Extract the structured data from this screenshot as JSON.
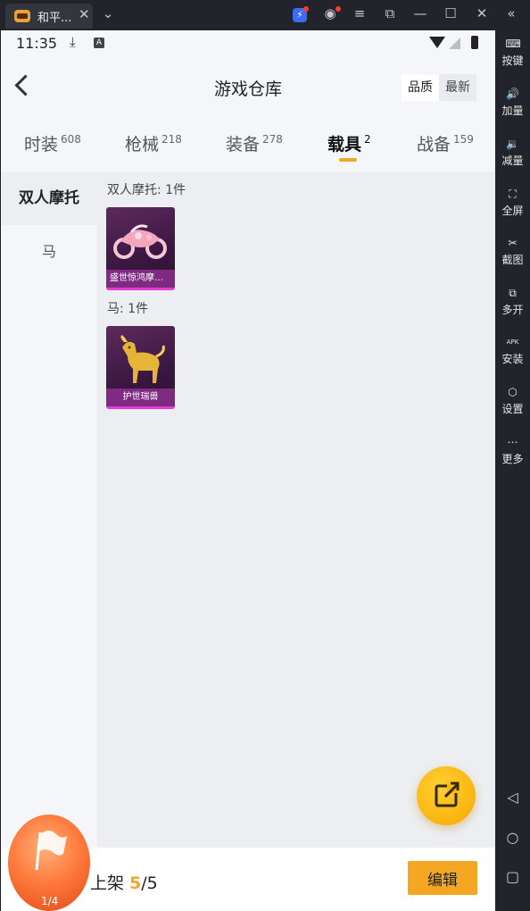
{
  "window": {
    "tab_title": "和平...",
    "tab_close": "✕",
    "controls": {
      "menu": "≡",
      "minimize": "—",
      "maximize": "☐",
      "close": "✕",
      "collapse": "«"
    }
  },
  "emulator_sidebar": {
    "items": [
      {
        "label": "按键",
        "icon": "keyboard-icon",
        "glyph": "⌨"
      },
      {
        "label": "加量",
        "icon": "volume-up-icon",
        "glyph": "🔊"
      },
      {
        "label": "减量",
        "icon": "volume-down-icon",
        "glyph": "🔉"
      },
      {
        "label": "全屏",
        "icon": "fullscreen-icon",
        "glyph": "⛶"
      },
      {
        "label": "截图",
        "icon": "scissors-icon",
        "glyph": "✂"
      },
      {
        "label": "多开",
        "icon": "multi-instance-icon",
        "glyph": "⧉"
      },
      {
        "label": "安装",
        "icon": "apk-install-icon",
        "glyph": "APK"
      },
      {
        "label": "设置",
        "icon": "settings-icon",
        "glyph": "⬡"
      },
      {
        "label": "更多",
        "icon": "more-icon",
        "glyph": "⋯"
      }
    ],
    "nav": {
      "back": "◁",
      "home": "○",
      "recents": "▢"
    }
  },
  "status_bar": {
    "time": "11:35"
  },
  "header": {
    "title": "游戏仓库",
    "sort_options": [
      "品质",
      "最新"
    ],
    "sort_selected": "品质"
  },
  "categories": [
    {
      "label": "时装",
      "count": "608"
    },
    {
      "label": "枪械",
      "count": "218"
    },
    {
      "label": "装备",
      "count": "278"
    },
    {
      "label": "载具",
      "count": "2"
    },
    {
      "label": "战备",
      "count": "159"
    }
  ],
  "active_category": "载具",
  "subcategories": [
    "双人摩托",
    "马"
  ],
  "active_subcategory": "双人摩托",
  "groups": [
    {
      "title": "双人摩托: 1件",
      "items": [
        {
          "name": "盛世惊鸿摩托..."
        }
      ]
    },
    {
      "title": "马: 1件",
      "items": [
        {
          "name": "护世瑞兽"
        }
      ]
    }
  ],
  "bottom": {
    "shelf_label": "上架 ",
    "shelf_count": "5",
    "shelf_total": "/5",
    "edit_label": "编辑",
    "orb_label": "1/4"
  },
  "colors": {
    "accent": "#f5a623",
    "card_bg": "#3a1840",
    "card_border": "#e63ad6"
  }
}
